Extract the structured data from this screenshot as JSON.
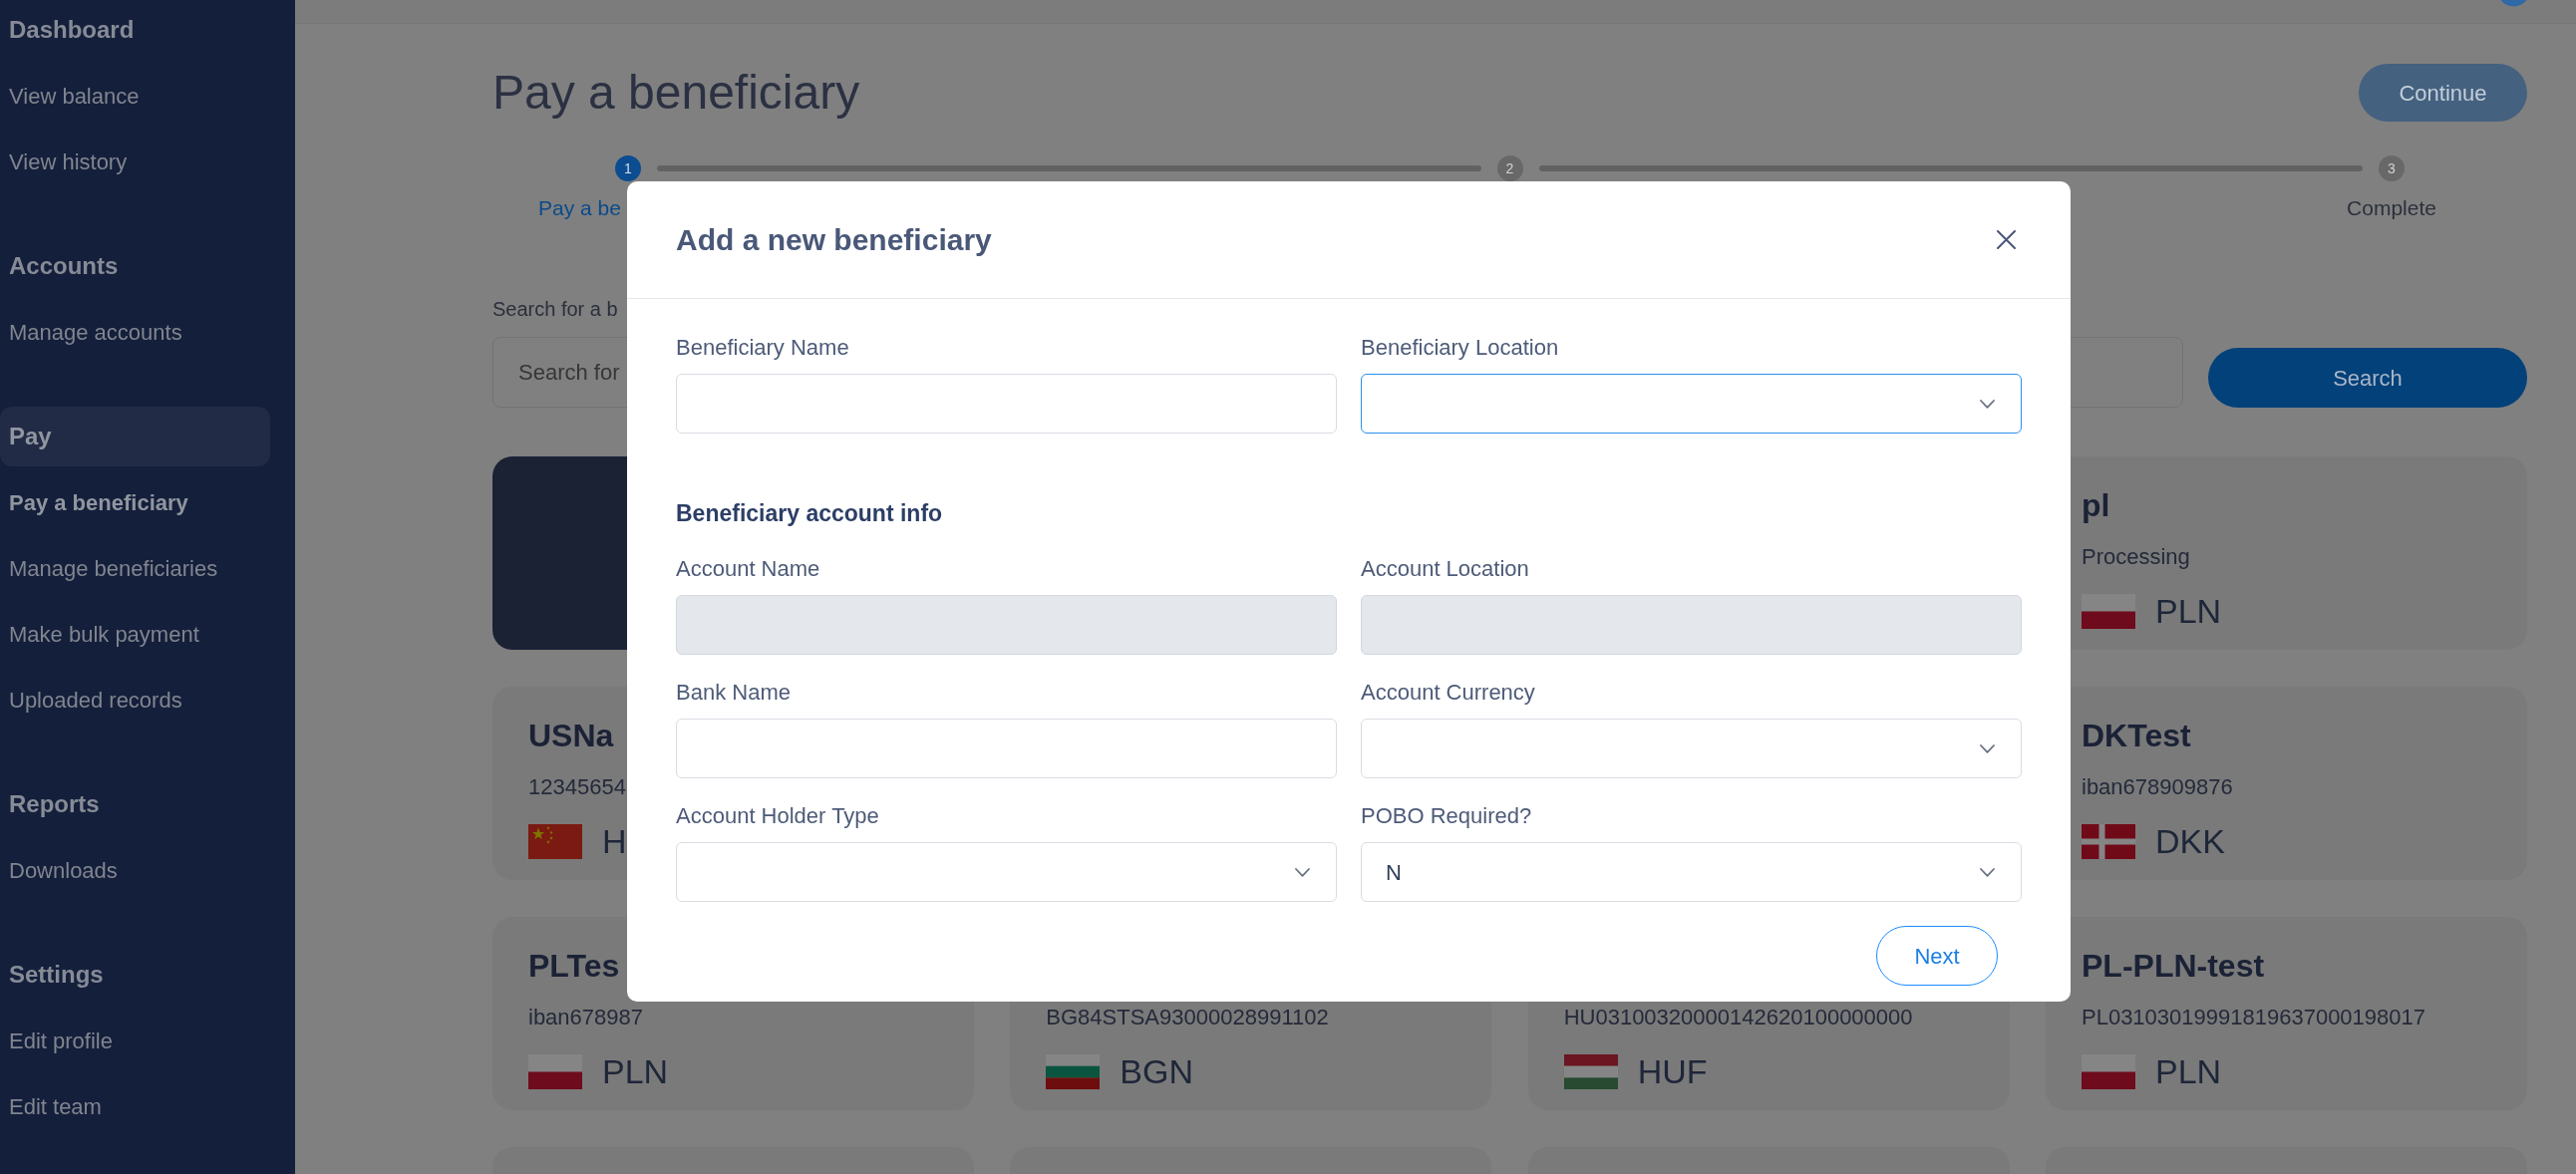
{
  "sidebar": {
    "groups": [
      {
        "heading": "Dashboard",
        "selected": false,
        "items": [
          {
            "label": "View balance",
            "selected": false
          },
          {
            "label": "View history",
            "selected": false
          }
        ]
      },
      {
        "heading": "Accounts",
        "selected": false,
        "items": [
          {
            "label": "Manage accounts",
            "selected": false
          }
        ]
      },
      {
        "heading": "Pay",
        "selected": true,
        "items": [
          {
            "label": "Pay a beneficiary",
            "selected": true
          },
          {
            "label": "Manage beneficiaries",
            "selected": false
          },
          {
            "label": "Make bulk payment",
            "selected": false
          },
          {
            "label": "Uploaded records",
            "selected": false
          }
        ]
      },
      {
        "heading": "Reports",
        "selected": false,
        "items": [
          {
            "label": "Downloads",
            "selected": false
          }
        ]
      },
      {
        "heading": "Settings",
        "selected": false,
        "items": [
          {
            "label": "Edit profile",
            "selected": false
          },
          {
            "label": "Edit team",
            "selected": false
          }
        ]
      }
    ]
  },
  "header": {
    "title": "Pay a beneficiary",
    "continue_button": {
      "label": "Continue",
      "disabled": true
    }
  },
  "stepper": {
    "steps": [
      {
        "number": "1",
        "label": "Pay a be",
        "selected": true
      },
      {
        "number": "2",
        "selected": false
      },
      {
        "number": "3",
        "label": "Complete",
        "selected": false
      }
    ]
  },
  "search": {
    "label": "Search for a b",
    "placeholder": "Search for",
    "button": "Search"
  },
  "card_rows": [
    {
      "cards": [
        {
          "kind": "filled"
        },
        {
          "kind": "account",
          "title": "pl",
          "subtitle": "Processing",
          "flag": {
            "kind": "pl"
          },
          "currency": "PLN"
        }
      ]
    },
    {
      "cards": [
        {
          "kind": "account",
          "title": "USNa",
          "subtitle": "12345654",
          "flag": {
            "kind": "cn"
          },
          "currency": "H"
        },
        {
          "kind": "account",
          "title": "DKTest",
          "subtitle": "iban678909876",
          "flag": {
            "kind": "dk"
          },
          "currency": "DKK"
        }
      ]
    },
    {
      "cards": [
        {
          "kind": "account",
          "title": "PLTes",
          "subtitle": "iban678987",
          "flag": {
            "kind": "pl"
          },
          "currency": "PLN"
        },
        {
          "kind": "account",
          "subtitle": "BG84STSA93000028991102",
          "flag": {
            "kind": "bg"
          },
          "currency": "BGN"
        },
        {
          "kind": "account",
          "subtitle": "HU03100320000142620100000000",
          "flag": {
            "kind": "hu"
          },
          "currency": "HUF"
        },
        {
          "kind": "account",
          "title": "PL-PLN-test",
          "subtitle": "PL03103019991819637000198017",
          "flag": {
            "kind": "pl"
          },
          "currency": "PLN"
        }
      ]
    },
    {
      "cards": [
        {
          "kind": "blank"
        },
        {
          "kind": "blank"
        },
        {
          "kind": "blank"
        },
        {
          "kind": "blank"
        }
      ]
    }
  ],
  "modal": {
    "title": "Add a new beneficiary",
    "sections": [
      {
        "fields": [
          {
            "label": "Beneficiary Name",
            "kind": "text",
            "focused": false,
            "disabled": false
          },
          {
            "label": "Beneficiary Location",
            "kind": "select",
            "focused": true,
            "disabled": false
          }
        ]
      },
      {
        "heading": "Beneficiary account info",
        "fields": [
          {
            "label": "Account Name",
            "kind": "text",
            "focused": false,
            "disabled": true
          },
          {
            "label": "Account Location",
            "kind": "text",
            "focused": false,
            "disabled": true
          },
          {
            "label": "Bank Name",
            "kind": "text",
            "focused": false,
            "disabled": false
          },
          {
            "label": "Account Currency",
            "kind": "select",
            "focused": false,
            "disabled": false
          },
          {
            "label": "Account Holder Type",
            "kind": "select",
            "focused": false,
            "disabled": false
          },
          {
            "label": "POBO Required?",
            "kind": "select",
            "focused": false,
            "disabled": false,
            "value": "N"
          }
        ]
      }
    ],
    "next_button": "Next"
  }
}
